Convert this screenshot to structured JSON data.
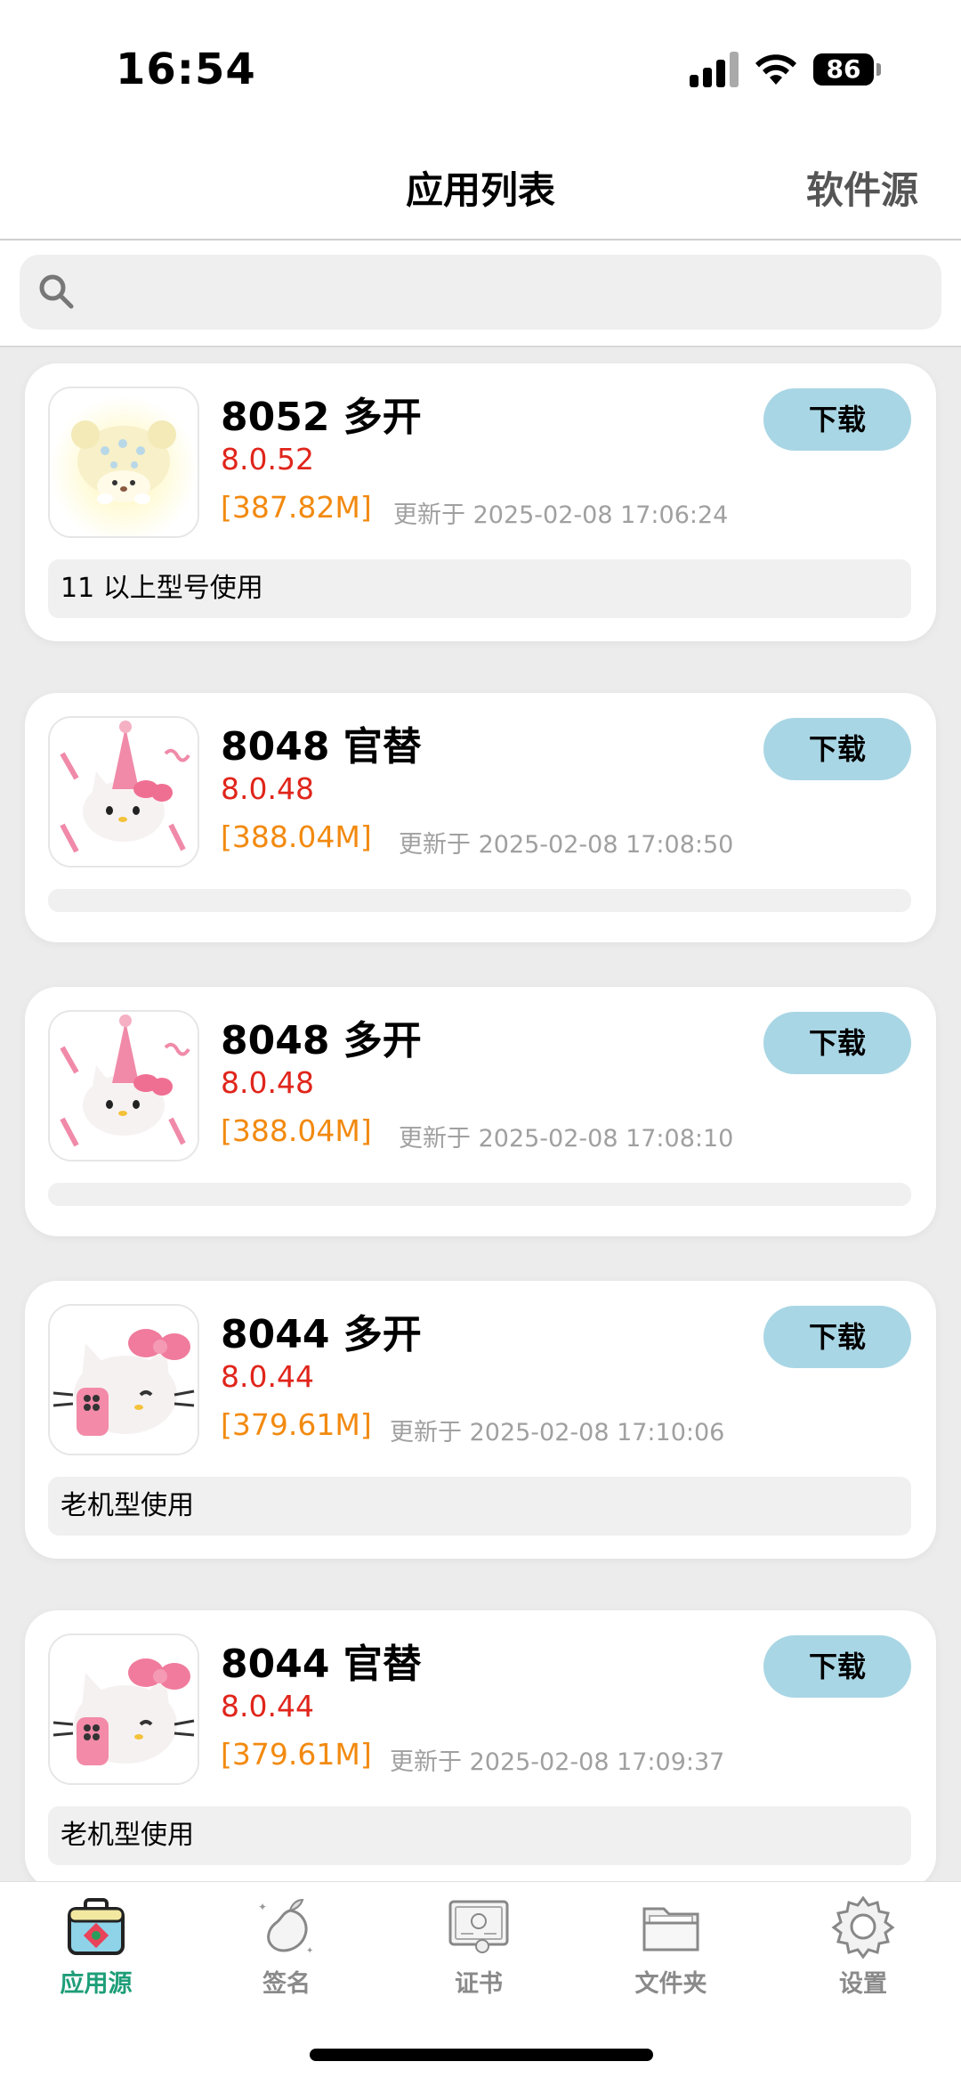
{
  "status_bar": {
    "time": "16:54",
    "battery": "86"
  },
  "nav": {
    "title": "应用列表",
    "right_action": "软件源"
  },
  "search": {
    "placeholder": "",
    "value": ""
  },
  "apps": [
    {
      "name": "8052 多开",
      "version": "8.0.52",
      "size": "[387.82M]",
      "updated": "更新于 2025-02-08 17:06:24",
      "note": "11 以上型号使用",
      "download_label": "下载",
      "icon": "bear-cream-icon"
    },
    {
      "name": "8048 官替",
      "version": "8.0.48",
      "size": "[388.04M]",
      "updated": "更新于 2025-02-08 17:08:50",
      "note": "",
      "download_label": "下载",
      "icon": "party-kitty-icon"
    },
    {
      "name": "8048 多开",
      "version": "8.0.48",
      "size": "[388.04M]",
      "updated": "更新于 2025-02-08 17:08:10",
      "note": "",
      "download_label": "下载",
      "icon": "party-kitty-icon"
    },
    {
      "name": "8044 多开",
      "version": "8.0.44",
      "size": "[379.61M]",
      "updated": "更新于 2025-02-08 17:10:06",
      "note": "老机型使用",
      "download_label": "下载",
      "icon": "phone-kitty-icon"
    },
    {
      "name": "8044 官替",
      "version": "8.0.44",
      "size": "[379.61M]",
      "updated": "更新于 2025-02-08 17:09:37",
      "note": "老机型使用",
      "download_label": "下载",
      "icon": "phone-kitty-icon"
    }
  ],
  "tabs": [
    {
      "label": "应用源",
      "icon": "bag-icon",
      "active": true
    },
    {
      "label": "签名",
      "icon": "mango-icon",
      "active": false
    },
    {
      "label": "证书",
      "icon": "certificate-icon",
      "active": false
    },
    {
      "label": "文件夹",
      "icon": "folder-icon",
      "active": false
    },
    {
      "label": "设置",
      "icon": "gear-icon",
      "active": false
    }
  ],
  "colors": {
    "accent": "#1e9e78",
    "download_button": "#a9d6e5",
    "version": "#e0251b",
    "size": "#f28a10"
  }
}
